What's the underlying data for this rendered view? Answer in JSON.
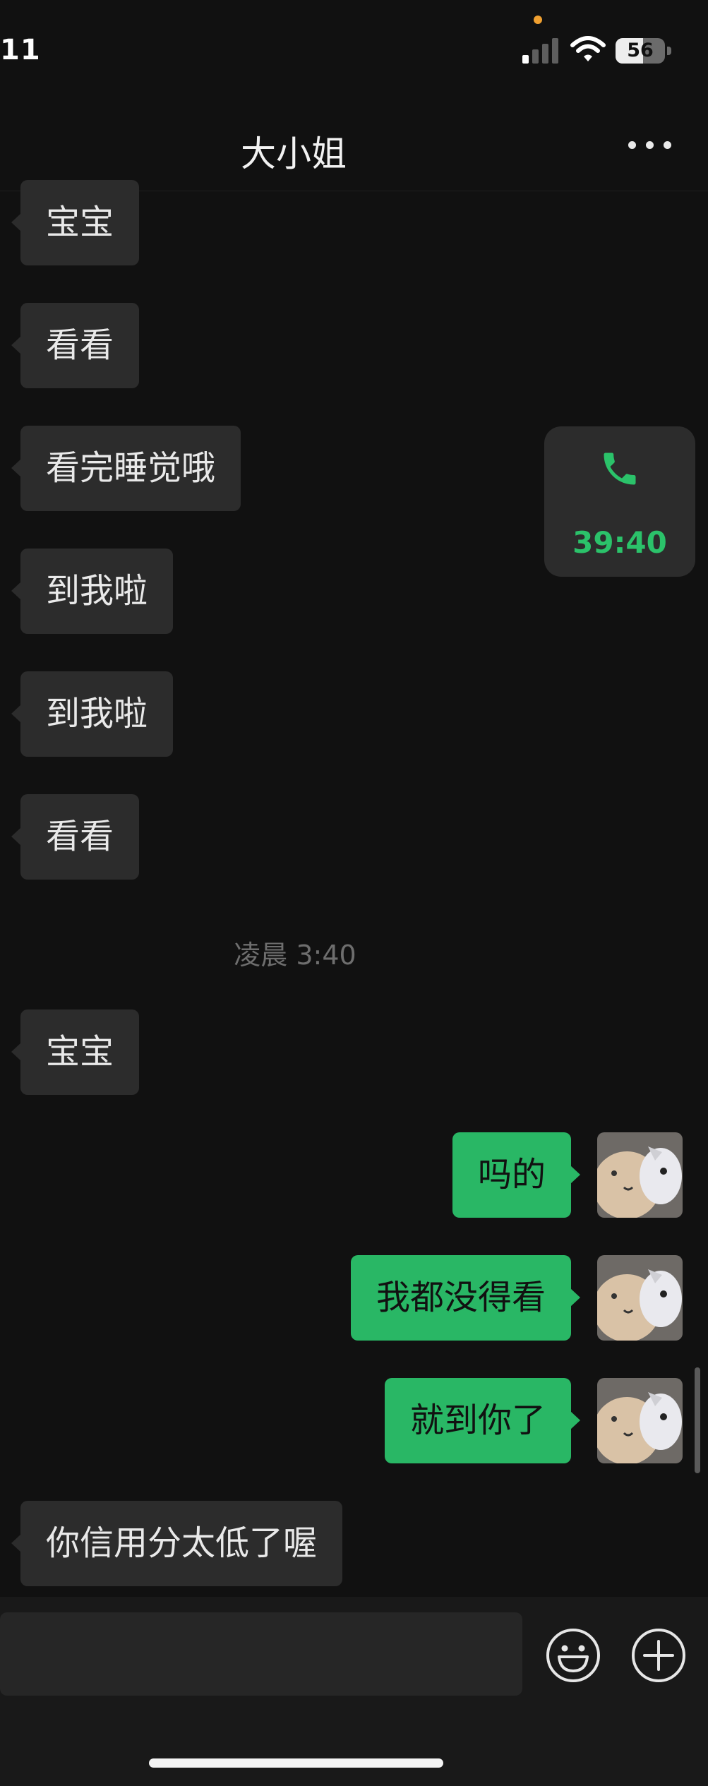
{
  "status_bar": {
    "time": "11",
    "battery": "56",
    "battery_level": 0.56
  },
  "header": {
    "title": "大小姐"
  },
  "messages": [
    {
      "dir": "in",
      "text": "宝宝"
    },
    {
      "dir": "in",
      "text": "看看"
    },
    {
      "dir": "in",
      "text": "看完睡觉哦"
    },
    {
      "dir": "in",
      "text": "到我啦"
    },
    {
      "dir": "in",
      "text": "到我啦"
    },
    {
      "dir": "in",
      "text": "看看"
    },
    {
      "dir": "in",
      "text": "宝宝"
    },
    {
      "dir": "out",
      "text": "吗的"
    },
    {
      "dir": "out",
      "text": "我都没得看"
    },
    {
      "dir": "out",
      "text": "就到你了"
    },
    {
      "dir": "in",
      "text": "你信用分太低了喔"
    }
  ],
  "call": {
    "duration": "39:40",
    "icon": "phone-icon",
    "color": "#2bc26a"
  },
  "timestamp": "凌晨 3:40",
  "colors": {
    "outgoing_bubble": "#29b765",
    "incoming_bubble": "#2c2c2c",
    "background": "#111111"
  },
  "input_bar": {
    "icons": [
      "emoji-icon",
      "plus-icon"
    ]
  }
}
